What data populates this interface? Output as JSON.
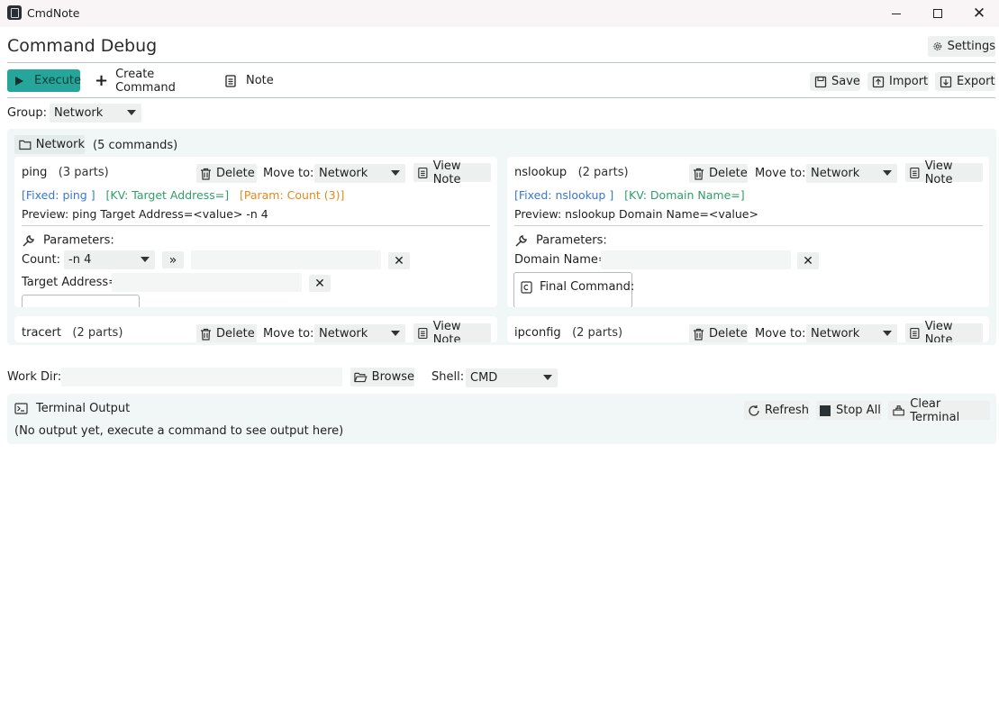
{
  "window": {
    "app_title": "CmdNote"
  },
  "page": {
    "title": "Command Debug",
    "settings_label": "Settings"
  },
  "toolbar": {
    "execute_label": "Execute",
    "create_label": "Create Command",
    "note_label": "Note",
    "save_label": "Save",
    "import_label": "Import",
    "export_label": "Export"
  },
  "group": {
    "label": "Group:",
    "selected": "Network"
  },
  "group_panel": {
    "name": "Network",
    "count_text": "(5 commands)",
    "move_to_label": "Move to:",
    "delete_label": "Delete",
    "view_note_label": "View Note",
    "parameters_label": "Parameters:",
    "final_command_label": "Final Command:",
    "cards": [
      {
        "name": "ping",
        "parts": "(3 parts)",
        "move_target": "Network",
        "tags": {
          "fixed": "[Fixed: ping ]",
          "kv": "[KV: Target Address=]",
          "param": "[Param: Count (3)]"
        },
        "preview": "Preview: ping  Target Address=<value> -n 4",
        "count_label": "Count:",
        "count_value": "-n 4",
        "target_label": "Target Address="
      },
      {
        "name": "nslookup",
        "parts": "(2 parts)",
        "move_target": "Network",
        "tags": {
          "fixed": "[Fixed: nslookup ]",
          "kv": "[KV: Domain Name=]"
        },
        "preview": "Preview: nslookup  Domain Name=<value>",
        "domain_label": "Domain Name="
      },
      {
        "name": "tracert",
        "parts": "(2 parts)",
        "move_target": "Network"
      },
      {
        "name": "ipconfig",
        "parts": "(2 parts)",
        "move_target": "Network"
      }
    ]
  },
  "workdir": {
    "label": "Work Dir:",
    "value": "",
    "browse_label": "Browse",
    "shell_label": "Shell:",
    "shell_value": "CMD"
  },
  "terminal": {
    "title": "Terminal Output",
    "refresh_label": "Refresh",
    "stop_label": "Stop All",
    "clear_label": "Clear Terminal",
    "output": "(No output yet, execute a command to see output here)"
  }
}
